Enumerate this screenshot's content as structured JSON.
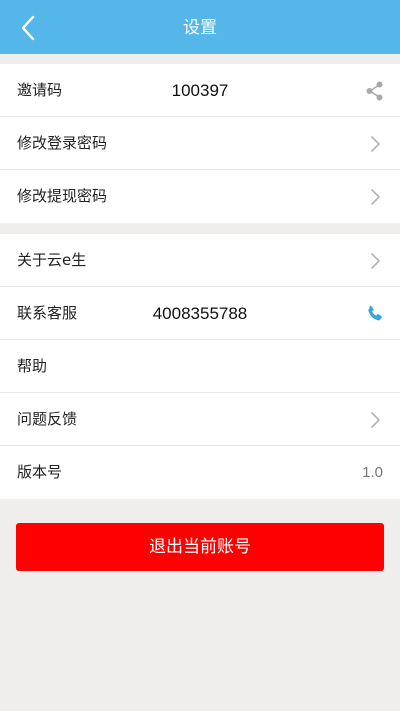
{
  "header": {
    "title": "设置",
    "back_icon": "chevron-left-icon"
  },
  "group1": {
    "invite": {
      "label": "邀请码",
      "value": "100397",
      "icon": "share-icon"
    },
    "change_login_password": {
      "label": "修改登录密码",
      "icon": "chevron-right-icon"
    },
    "change_withdraw_password": {
      "label": "修改提现密码",
      "icon": "chevron-right-icon"
    }
  },
  "group2": {
    "about": {
      "label": "关于云e生",
      "icon": "chevron-right-icon"
    },
    "customer_service": {
      "label": "联系客服",
      "value": "4008355788",
      "icon": "phone-icon"
    },
    "help": {
      "label": "帮助"
    },
    "feedback": {
      "label": "问题反馈",
      "icon": "chevron-right-icon"
    },
    "version": {
      "label": "版本号",
      "value": "1.0"
    }
  },
  "logout": {
    "label": "退出当前账号"
  },
  "colors": {
    "header_bg": "#55b6ea",
    "logout_bg": "#fe0000",
    "phone_icon": "#3aa6de",
    "page_bg": "#efeeed"
  }
}
